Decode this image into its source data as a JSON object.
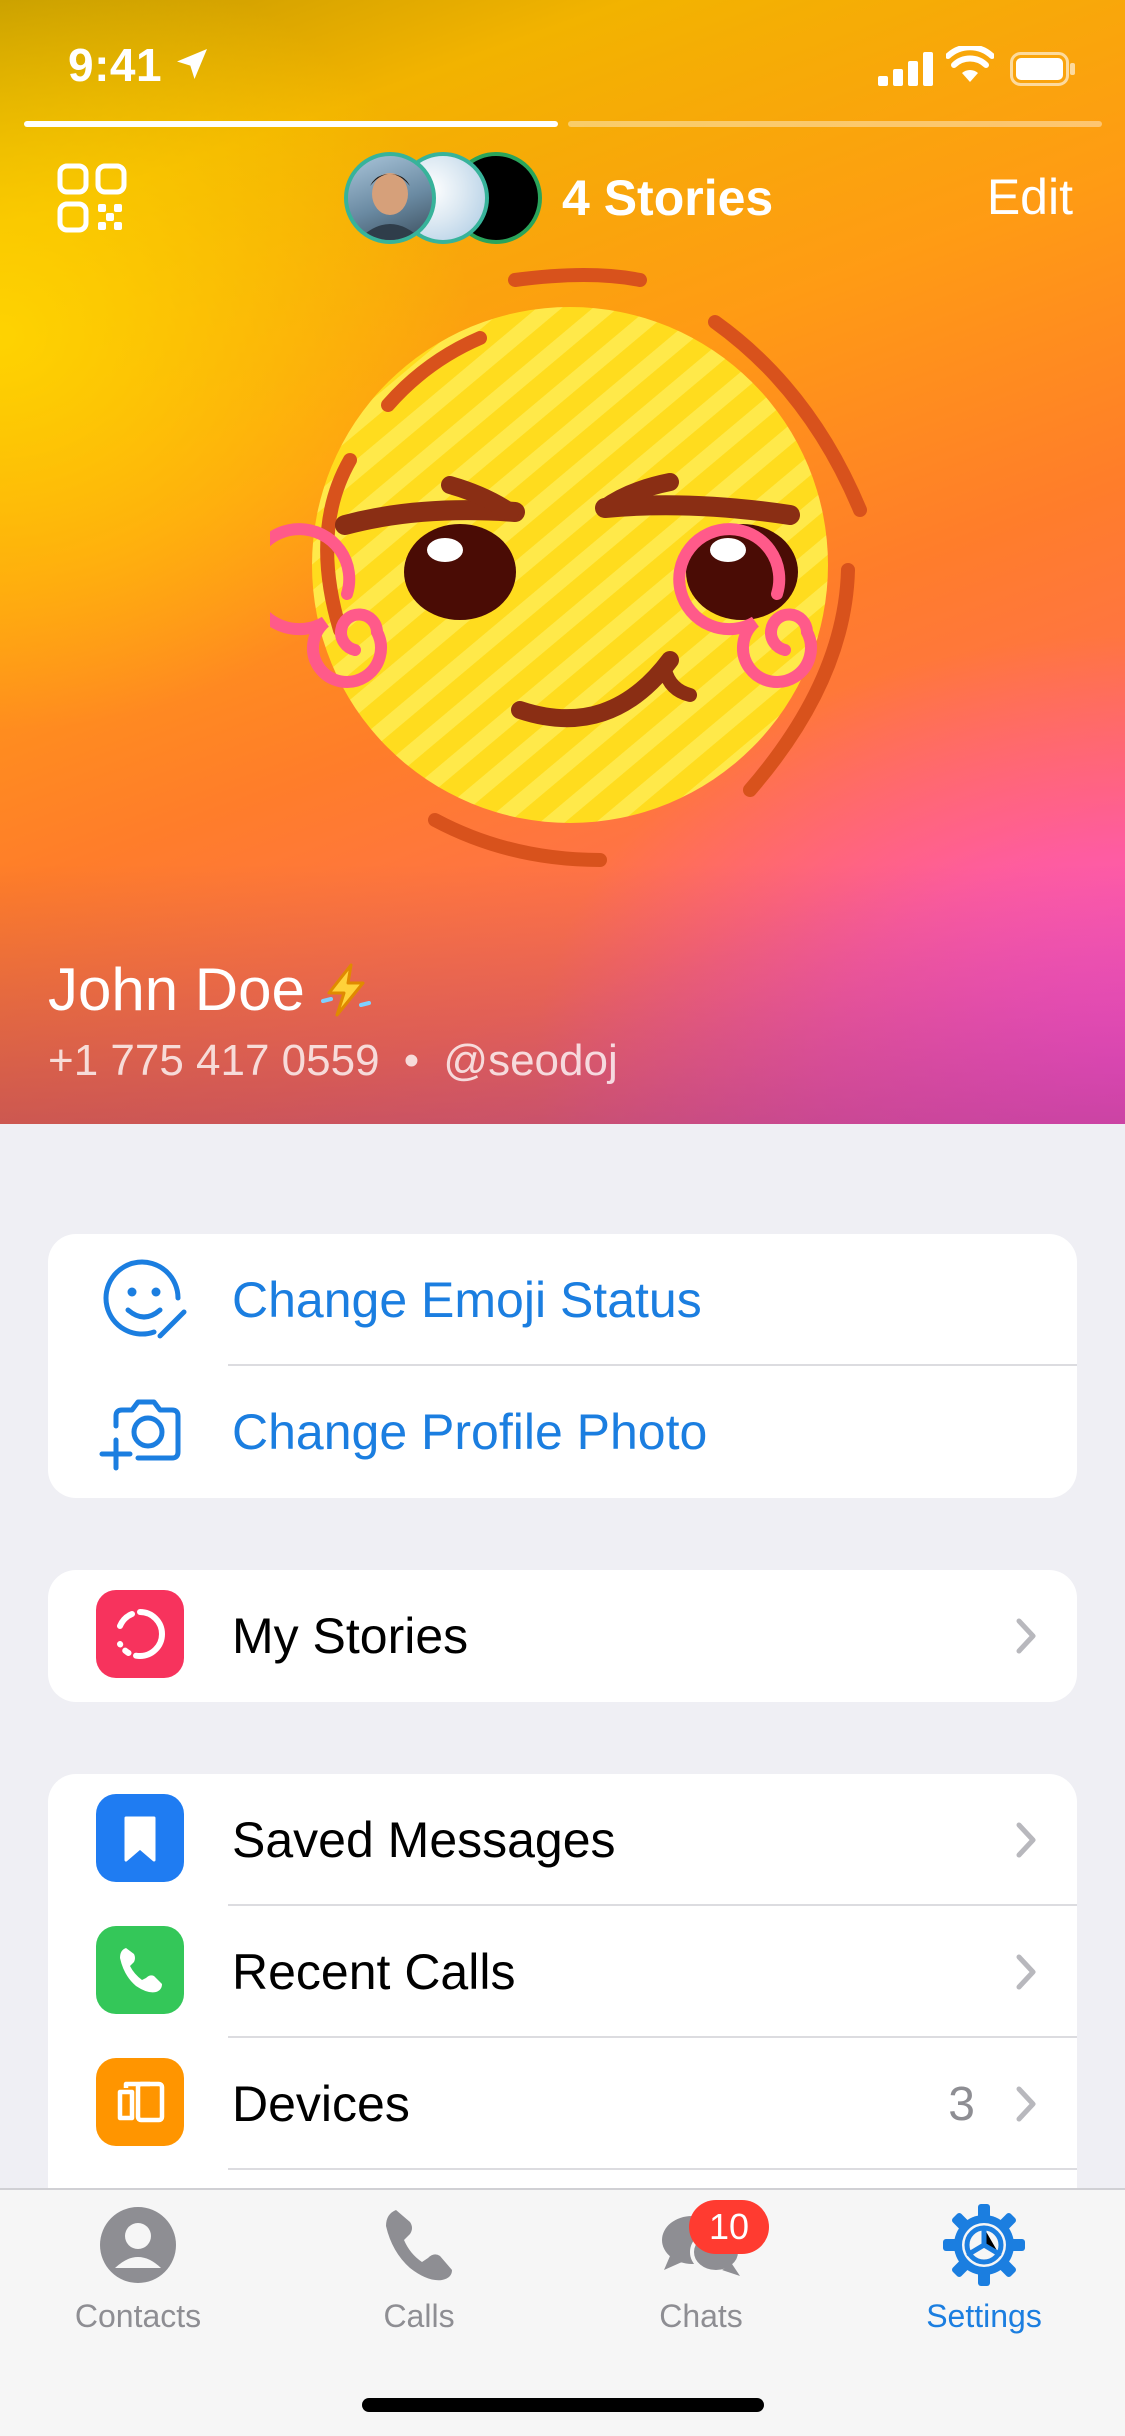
{
  "status_bar": {
    "time": "9:41"
  },
  "header": {
    "stories_label": "4 Stories",
    "edit_label": "Edit"
  },
  "profile": {
    "name": "John Doe",
    "phone": "+1 775 417 0559",
    "separator": "•",
    "username": "@seodoj"
  },
  "actions": [
    {
      "label": "Change Emoji Status",
      "icon": "emoji-status-icon"
    },
    {
      "label": "Change Profile Photo",
      "icon": "add-photo-icon"
    }
  ],
  "stories_item": {
    "label": "My Stories",
    "icon": "stories-icon",
    "color": "#f7335d"
  },
  "menu": [
    {
      "label": "Saved Messages",
      "icon": "bookmark-icon",
      "color": "#1f7cf2",
      "value": ""
    },
    {
      "label": "Recent Calls",
      "icon": "phone-icon",
      "color": "#34c759",
      "value": ""
    },
    {
      "label": "Devices",
      "icon": "devices-icon",
      "color": "#ff9500",
      "value": "3"
    }
  ],
  "tabs": [
    {
      "label": "Contacts",
      "icon": "person-icon",
      "active": false
    },
    {
      "label": "Calls",
      "icon": "phone-icon",
      "active": false
    },
    {
      "label": "Chats",
      "icon": "chat-bubbles-icon",
      "badge": "10",
      "active": false
    },
    {
      "label": "Settings",
      "icon": "gear-icon",
      "active": true
    }
  ],
  "colors": {
    "accent": "#1b7ee0",
    "badge": "#ff3b30",
    "background": "#efeff4"
  }
}
